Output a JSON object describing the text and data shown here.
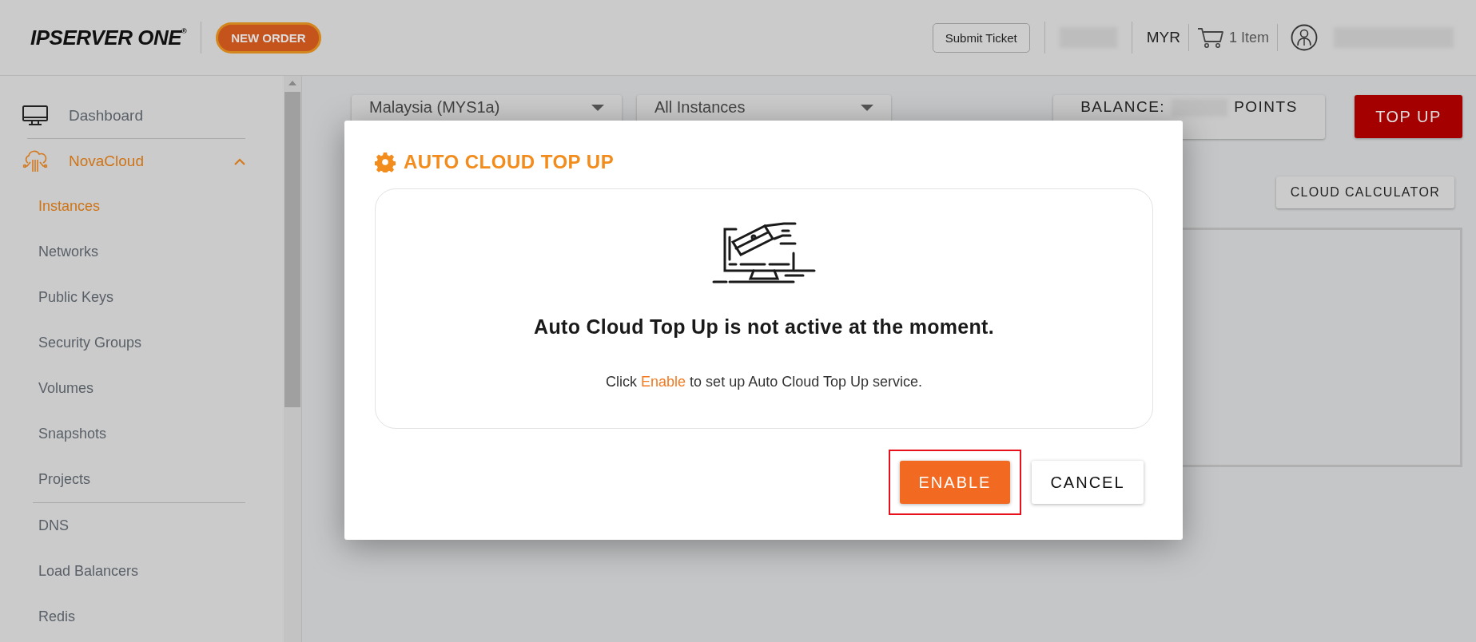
{
  "header": {
    "logo": {
      "text": "IPSERVER ONE",
      "mark": "®"
    },
    "new_order": "NEW ORDER",
    "submit_ticket": "Submit Ticket",
    "currency": "MYR",
    "cart": "1 Item"
  },
  "sidebar": {
    "items": [
      {
        "label": "Dashboard",
        "kind": "monitor",
        "selected": false
      },
      {
        "label": "NovaCloud",
        "kind": "cloud",
        "selected": true,
        "expanded": true,
        "groups": [
          [
            {
              "label": "Instances",
              "selected": true
            },
            {
              "label": "Networks",
              "selected": false
            },
            {
              "label": "Public Keys",
              "selected": false
            },
            {
              "label": "Security Groups",
              "selected": false
            },
            {
              "label": "Volumes",
              "selected": false
            },
            {
              "label": "Snapshots",
              "selected": false
            },
            {
              "label": "Projects",
              "selected": false
            }
          ],
          [
            {
              "label": "DNS",
              "selected": false
            },
            {
              "label": "Load Balancers",
              "selected": false
            },
            {
              "label": "Redis",
              "selected": false
            }
          ]
        ]
      }
    ]
  },
  "toolbar": {
    "region": "Malaysia (MYS1a)",
    "filter": "All Instances",
    "balance_label": "BALANCE:",
    "balance_unit": "POINTS",
    "top_up": "TOP UP",
    "cloud_calculator": "CLOUD CALCULATOR"
  },
  "modal": {
    "title": "AUTO CLOUD TOP UP",
    "heading": "Auto Cloud Top Up is not active at the moment.",
    "message_before": "Click",
    "message_link": "Enable",
    "message_after": "to set up Auto Cloud Top Up service.",
    "buttons": [
      {
        "label": "ENABLE",
        "kind": "primary",
        "highlighted": true
      },
      {
        "label": "CANCEL",
        "kind": "secondary",
        "highlighted": false
      }
    ]
  }
}
